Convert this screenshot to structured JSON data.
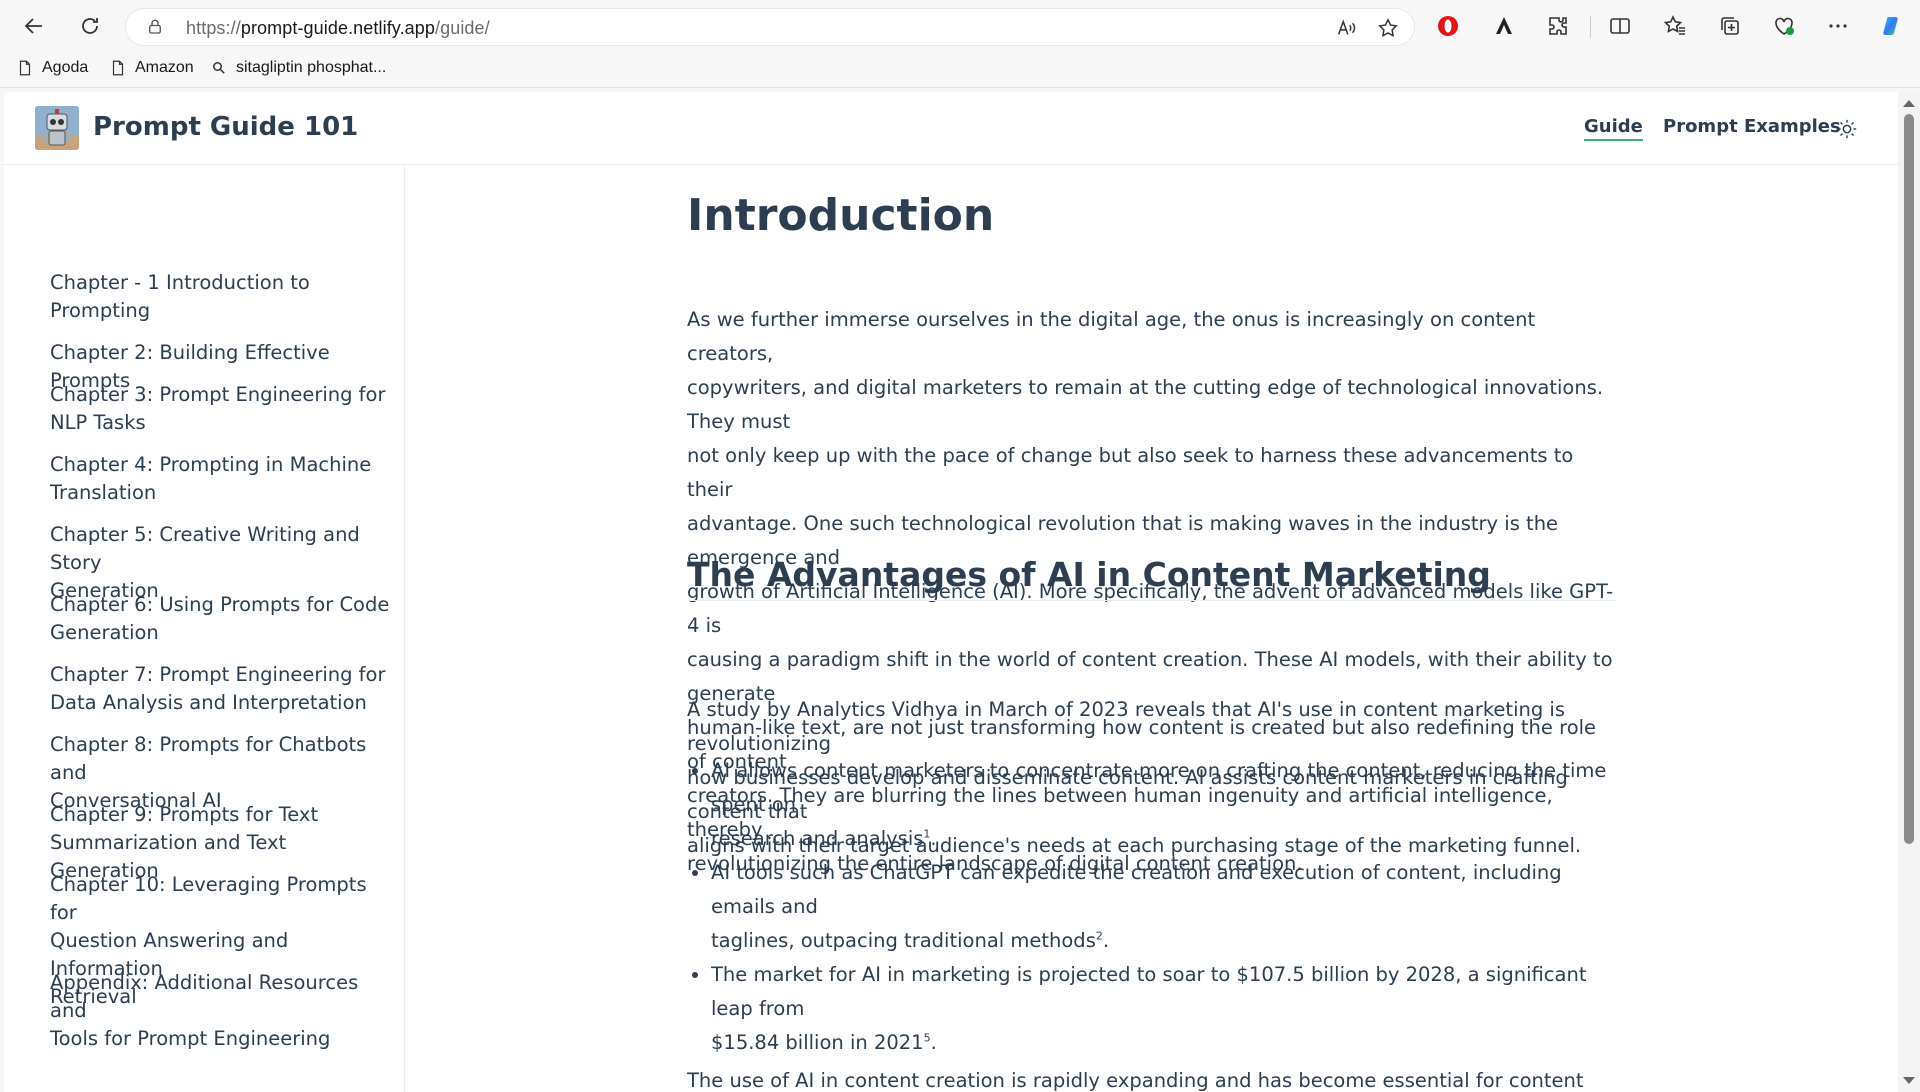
{
  "browser": {
    "url_prefix": "https://",
    "url_host": "prompt-guide.netlify.app",
    "url_path": "/guide/",
    "bookmarks": [
      "Agoda",
      "Amazon",
      "sitagliptin phosphat..."
    ]
  },
  "site": {
    "name": "Prompt Guide 101",
    "nav": [
      "Guide",
      "Prompt Examples"
    ]
  },
  "sidebar": {
    "items": [
      {
        "line1": "Chapter - 1 Introduction to",
        "line2": "Prompting"
      },
      {
        "line1": "Chapter 2: Building Effective Prompts",
        "line2": ""
      },
      {
        "line1": "Chapter 3: Prompt Engineering for",
        "line2": "NLP Tasks"
      },
      {
        "line1": "Chapter 4: Prompting in Machine",
        "line2": "Translation"
      },
      {
        "line1": "Chapter 5: Creative Writing and Story",
        "line2": "Generation"
      },
      {
        "line1": "Chapter 6: Using Prompts for Code",
        "line2": "Generation"
      },
      {
        "line1": "Chapter 7: Prompt Engineering for",
        "line2": "Data Analysis and Interpretation"
      },
      {
        "line1": "Chapter 8: Prompts for Chatbots and",
        "line2": "Conversational AI"
      },
      {
        "line1": "Chapter 9: Prompts for Text",
        "line2": "Summarization and Text Generation"
      },
      {
        "line1": "Chapter 10: Leveraging Prompts for",
        "line2": "Question Answering and Information",
        "line3": "Retrieval"
      },
      {
        "line1": "Appendix: Additional Resources and",
        "line2": "Tools for Prompt Engineering"
      }
    ]
  },
  "content": {
    "title": "Introduction",
    "intro_lines": [
      "As we further immerse ourselves in the digital age, the onus is increasingly on content creators,",
      "copywriters, and digital marketers to remain at the cutting edge of technological innovations. They must",
      "not only keep up with the pace of change but also seek to harness these advancements to their",
      "advantage. One such technological revolution that is making waves in the industry is the emergence and",
      "growth of Artificial Intelligence (AI). More specifically, the advent of advanced models like GPT-4 is",
      "causing a paradigm shift in the world of content creation. These AI models, with their ability to generate",
      "human-like text, are not just transforming how content is created but also redefining the role of content",
      "creators. They are blurring the lines between human ingenuity and artificial intelligence, thereby",
      "revolutionizing the entire landscape of digital content creation."
    ],
    "section_title": "The Advantages of AI in Content Marketing",
    "section_lines": [
      "A study by Analytics Vidhya in March of 2023 reveals that AI's use in content marketing is revolutionizing",
      "how businesses develop and disseminate content. AI assists content marketers in crafting content that",
      "aligns with their target audience's needs at each purchasing stage of the marketing funnel."
    ],
    "bullets": [
      {
        "line1": "AI allows content marketers to concentrate more on crafting the content, reducing the time spent on",
        "line2": "research and analysis",
        "sup": "1",
        "end": "."
      },
      {
        "line1": "AI tools such as ChatGPT can expedite the creation and execution of content, including emails and",
        "line2": "taglines, outpacing traditional methods",
        "sup": "2",
        "end": "."
      },
      {
        "line1": "The market for AI in marketing is projected to soar to $107.5 billion by 2028, a significant leap from",
        "line2": "$15.84 billion in 2021",
        "sup": "5",
        "end": "."
      }
    ],
    "trailing_line": "The use of AI in content creation is rapidly expanding and has become essential for content creators and"
  },
  "colors": {
    "accent": "#3eaf7c",
    "text": "#2c3e50"
  }
}
